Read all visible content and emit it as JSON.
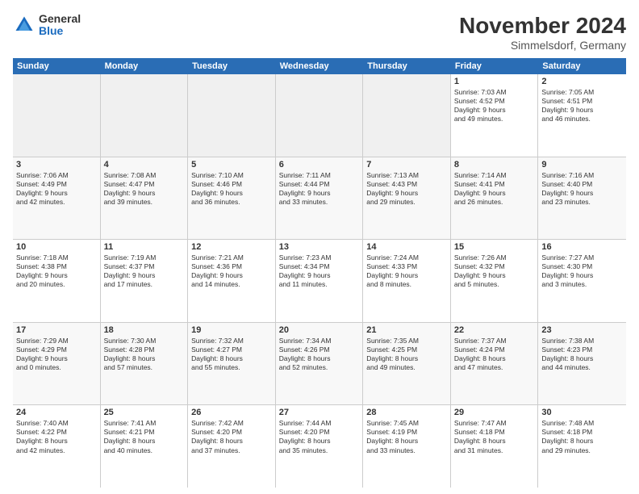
{
  "logo": {
    "general": "General",
    "blue": "Blue"
  },
  "title": "November 2024",
  "subtitle": "Simmelsdorf, Germany",
  "weekdays": [
    "Sunday",
    "Monday",
    "Tuesday",
    "Wednesday",
    "Thursday",
    "Friday",
    "Saturday"
  ],
  "weeks": [
    [
      {
        "day": "",
        "info": ""
      },
      {
        "day": "",
        "info": ""
      },
      {
        "day": "",
        "info": ""
      },
      {
        "day": "",
        "info": ""
      },
      {
        "day": "",
        "info": ""
      },
      {
        "day": "1",
        "info": "Sunrise: 7:03 AM\nSunset: 4:52 PM\nDaylight: 9 hours\nand 49 minutes."
      },
      {
        "day": "2",
        "info": "Sunrise: 7:05 AM\nSunset: 4:51 PM\nDaylight: 9 hours\nand 46 minutes."
      }
    ],
    [
      {
        "day": "3",
        "info": "Sunrise: 7:06 AM\nSunset: 4:49 PM\nDaylight: 9 hours\nand 42 minutes."
      },
      {
        "day": "4",
        "info": "Sunrise: 7:08 AM\nSunset: 4:47 PM\nDaylight: 9 hours\nand 39 minutes."
      },
      {
        "day": "5",
        "info": "Sunrise: 7:10 AM\nSunset: 4:46 PM\nDaylight: 9 hours\nand 36 minutes."
      },
      {
        "day": "6",
        "info": "Sunrise: 7:11 AM\nSunset: 4:44 PM\nDaylight: 9 hours\nand 33 minutes."
      },
      {
        "day": "7",
        "info": "Sunrise: 7:13 AM\nSunset: 4:43 PM\nDaylight: 9 hours\nand 29 minutes."
      },
      {
        "day": "8",
        "info": "Sunrise: 7:14 AM\nSunset: 4:41 PM\nDaylight: 9 hours\nand 26 minutes."
      },
      {
        "day": "9",
        "info": "Sunrise: 7:16 AM\nSunset: 4:40 PM\nDaylight: 9 hours\nand 23 minutes."
      }
    ],
    [
      {
        "day": "10",
        "info": "Sunrise: 7:18 AM\nSunset: 4:38 PM\nDaylight: 9 hours\nand 20 minutes."
      },
      {
        "day": "11",
        "info": "Sunrise: 7:19 AM\nSunset: 4:37 PM\nDaylight: 9 hours\nand 17 minutes."
      },
      {
        "day": "12",
        "info": "Sunrise: 7:21 AM\nSunset: 4:36 PM\nDaylight: 9 hours\nand 14 minutes."
      },
      {
        "day": "13",
        "info": "Sunrise: 7:23 AM\nSunset: 4:34 PM\nDaylight: 9 hours\nand 11 minutes."
      },
      {
        "day": "14",
        "info": "Sunrise: 7:24 AM\nSunset: 4:33 PM\nDaylight: 9 hours\nand 8 minutes."
      },
      {
        "day": "15",
        "info": "Sunrise: 7:26 AM\nSunset: 4:32 PM\nDaylight: 9 hours\nand 5 minutes."
      },
      {
        "day": "16",
        "info": "Sunrise: 7:27 AM\nSunset: 4:30 PM\nDaylight: 9 hours\nand 3 minutes."
      }
    ],
    [
      {
        "day": "17",
        "info": "Sunrise: 7:29 AM\nSunset: 4:29 PM\nDaylight: 9 hours\nand 0 minutes."
      },
      {
        "day": "18",
        "info": "Sunrise: 7:30 AM\nSunset: 4:28 PM\nDaylight: 8 hours\nand 57 minutes."
      },
      {
        "day": "19",
        "info": "Sunrise: 7:32 AM\nSunset: 4:27 PM\nDaylight: 8 hours\nand 55 minutes."
      },
      {
        "day": "20",
        "info": "Sunrise: 7:34 AM\nSunset: 4:26 PM\nDaylight: 8 hours\nand 52 minutes."
      },
      {
        "day": "21",
        "info": "Sunrise: 7:35 AM\nSunset: 4:25 PM\nDaylight: 8 hours\nand 49 minutes."
      },
      {
        "day": "22",
        "info": "Sunrise: 7:37 AM\nSunset: 4:24 PM\nDaylight: 8 hours\nand 47 minutes."
      },
      {
        "day": "23",
        "info": "Sunrise: 7:38 AM\nSunset: 4:23 PM\nDaylight: 8 hours\nand 44 minutes."
      }
    ],
    [
      {
        "day": "24",
        "info": "Sunrise: 7:40 AM\nSunset: 4:22 PM\nDaylight: 8 hours\nand 42 minutes."
      },
      {
        "day": "25",
        "info": "Sunrise: 7:41 AM\nSunset: 4:21 PM\nDaylight: 8 hours\nand 40 minutes."
      },
      {
        "day": "26",
        "info": "Sunrise: 7:42 AM\nSunset: 4:20 PM\nDaylight: 8 hours\nand 37 minutes."
      },
      {
        "day": "27",
        "info": "Sunrise: 7:44 AM\nSunset: 4:20 PM\nDaylight: 8 hours\nand 35 minutes."
      },
      {
        "day": "28",
        "info": "Sunrise: 7:45 AM\nSunset: 4:19 PM\nDaylight: 8 hours\nand 33 minutes."
      },
      {
        "day": "29",
        "info": "Sunrise: 7:47 AM\nSunset: 4:18 PM\nDaylight: 8 hours\nand 31 minutes."
      },
      {
        "day": "30",
        "info": "Sunrise: 7:48 AM\nSunset: 4:18 PM\nDaylight: 8 hours\nand 29 minutes."
      }
    ]
  ]
}
